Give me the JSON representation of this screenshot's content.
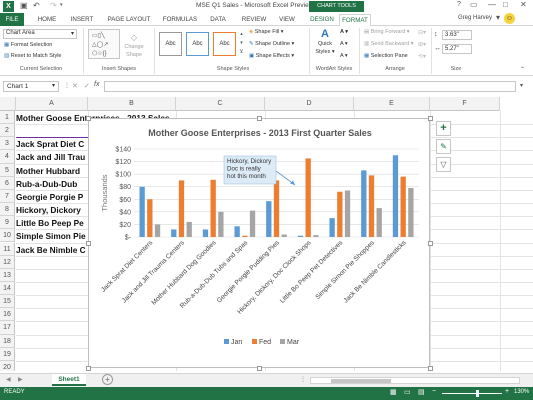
{
  "window": {
    "title": "MSE Q1 Sales - Microsoft Excel Preview",
    "context_tab_group": "CHART TOOLS",
    "user": "Greg Harvey",
    "help": "?"
  },
  "tabs": [
    {
      "label": "FILE"
    },
    {
      "label": "HOME"
    },
    {
      "label": "INSERT"
    },
    {
      "label": "PAGE LAYOUT"
    },
    {
      "label": "FORMULAS"
    },
    {
      "label": "DATA"
    },
    {
      "label": "REVIEW"
    },
    {
      "label": "VIEW"
    },
    {
      "label": "DESIGN"
    },
    {
      "label": "FORMAT"
    }
  ],
  "ribbon": {
    "current_selection": {
      "dropdown_value": "Chart Area",
      "format_selection": "Format Selection",
      "reset": "Reset to Match Style",
      "label": "Current Selection"
    },
    "insert_shapes": {
      "change_shape_1": "Change",
      "change_shape_2": "Shape",
      "label": "Insert Shapes"
    },
    "shape_styles": {
      "swatch_label": "Abc",
      "fill": "Shape Fill",
      "outline": "Shape Outline",
      "effects": "Shape Effects",
      "label": "Shape Styles"
    },
    "wordart": {
      "quick_styles_1": "Quick",
      "quick_styles_2": "Styles",
      "label": "WordArt Styles"
    },
    "arrange": {
      "bring_forward": "Bring Forward",
      "send_backward": "Send Backward",
      "selection_pane": "Selection Pane",
      "label": "Arrange"
    },
    "size": {
      "height": "3.63\"",
      "width": "5.27\"",
      "label": "Size"
    }
  },
  "formula_bar": {
    "name_box": "Chart 1",
    "fx": "fx",
    "value": ""
  },
  "columns": [
    "A",
    "B",
    "C",
    "D",
    "E",
    "F"
  ],
  "rows": [
    "1",
    "2",
    "3",
    "4",
    "5",
    "6",
    "7",
    "8",
    "9",
    "10",
    "11",
    "12",
    "13",
    "14",
    "15",
    "16",
    "17",
    "18",
    "19",
    "20"
  ],
  "cells": [
    "Mother Goose Enterprises - 2013 Sales",
    "",
    "Jack Sprat Diet C",
    "Jack and Jill Trau",
    "Mother Hubbard",
    "Rub-a-Dub-Dub",
    "Georgie Porgie P",
    "Hickory, Dickory",
    "Little Bo Peep Pe",
    "Simple Simon Pie",
    "Jack Be Nimble C"
  ],
  "chart_data": {
    "type": "bar",
    "title": "Mother Goose Enterprises - 2013 First Quarter Sales",
    "ylabel": "Thousands",
    "ylim": [
      0,
      140
    ],
    "yticks": [
      "$-",
      "$20",
      "$40",
      "$60",
      "$80",
      "$100",
      "$120",
      "$140"
    ],
    "categories": [
      "Jack Sprat Diet Centers",
      "Jack and Jill Trauma Centers",
      "Mother Hubbard Dog Goodies",
      "Rub-a-Dub-Dub Tubs and Spas",
      "Georgie Porgie Pudding Pies",
      "Hickory, Dickory, Doc Clock Shops",
      "Little Bo Peep Pet Detectives",
      "Simple Simon Pie Shoppes",
      "Jack Be Nimble Candlesticks"
    ],
    "series": [
      {
        "name": "Jan",
        "color": "#5b9bd5",
        "values": [
          80,
          12,
          12,
          17,
          57,
          2,
          30,
          106,
          130
        ]
      },
      {
        "name": "Fed",
        "color": "#ed7d31",
        "values": [
          60,
          90,
          91,
          2,
          90,
          125,
          72,
          98,
          96
        ]
      },
      {
        "name": "Mar",
        "color": "#a5a5a5",
        "values": [
          20,
          24,
          40,
          42,
          4,
          3,
          74,
          46,
          78
        ]
      }
    ],
    "legend_position": "bottom",
    "callout": "Hickory, Dickory, Doc is really hot this month"
  },
  "side_buttons": {
    "add": "+",
    "brush": "brush-icon",
    "filter": "filter-icon"
  },
  "sheet_tab": "Sheet1",
  "status": {
    "ready": "READY",
    "zoom": "130%"
  }
}
